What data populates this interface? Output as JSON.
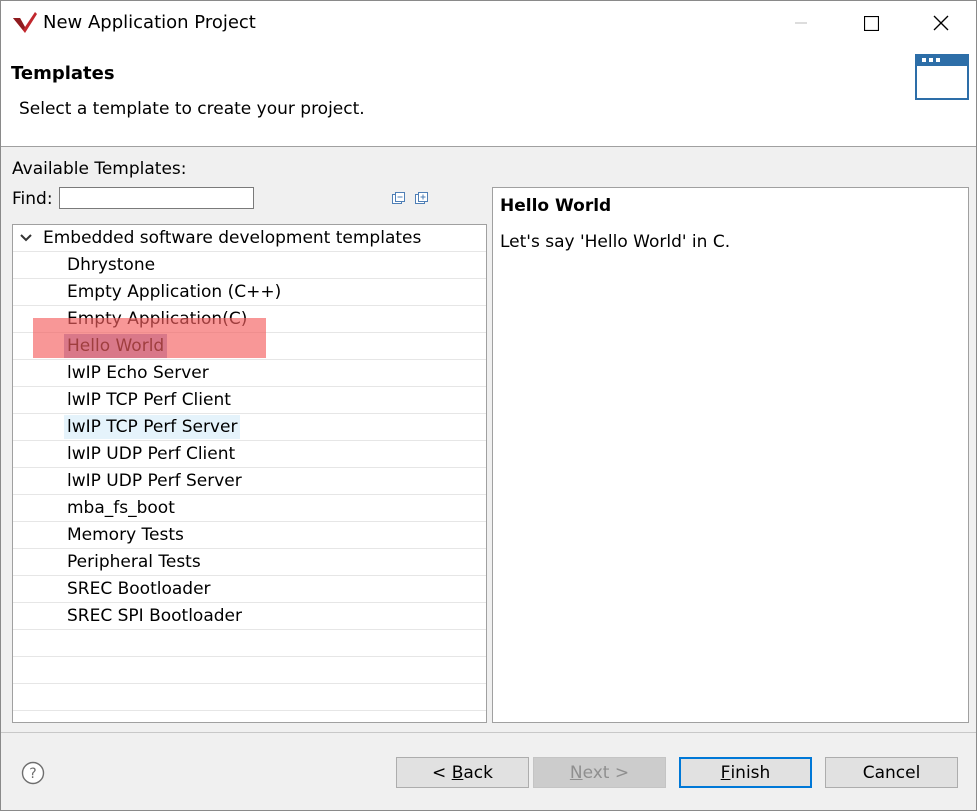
{
  "window": {
    "title": "New Application Project"
  },
  "header": {
    "title": "Templates",
    "description": "Select a template to create your project."
  },
  "main": {
    "available_label": "Available Templates:",
    "find_label": "Find:",
    "find_value": "",
    "tree": {
      "group_label": "Embedded software development templates",
      "items": [
        {
          "label": "Dhrystone"
        },
        {
          "label": "Empty Application (C++)"
        },
        {
          "label": "Empty Application(C)"
        },
        {
          "label": "Hello World"
        },
        {
          "label": "lwIP Echo Server"
        },
        {
          "label": "lwIP TCP Perf Client"
        },
        {
          "label": "lwIP TCP Perf Server"
        },
        {
          "label": "lwIP UDP Perf Client"
        },
        {
          "label": "lwIP UDP Perf Server"
        },
        {
          "label": "mba_fs_boot"
        },
        {
          "label": "Memory Tests"
        },
        {
          "label": "Peripheral Tests"
        },
        {
          "label": "SREC Bootloader"
        },
        {
          "label": "SREC SPI Bootloader"
        }
      ]
    },
    "description_panel": {
      "title": "Hello World",
      "text": "Let's say 'Hello World' in C."
    }
  },
  "footer": {
    "back": {
      "prefix": "< ",
      "mnemonic": "B",
      "rest": "ack"
    },
    "next": {
      "mnemonic": "N",
      "rest": "ext >"
    },
    "finish": {
      "mnemonic": "F",
      "rest": "inish"
    },
    "cancel": "Cancel"
  },
  "colors": {
    "accent": "#0078d7",
    "selection": "#a6a6d6",
    "hover": "#e5f3fb",
    "annotation_highlight": "#f55f5f",
    "brand_red": "#c1272d"
  },
  "icons": [
    "app-logo-icon",
    "minimize-icon",
    "maximize-icon",
    "close-icon",
    "window-icon",
    "collapse-all-icon",
    "expand-all-icon",
    "chevron-down-icon",
    "help-icon"
  ]
}
